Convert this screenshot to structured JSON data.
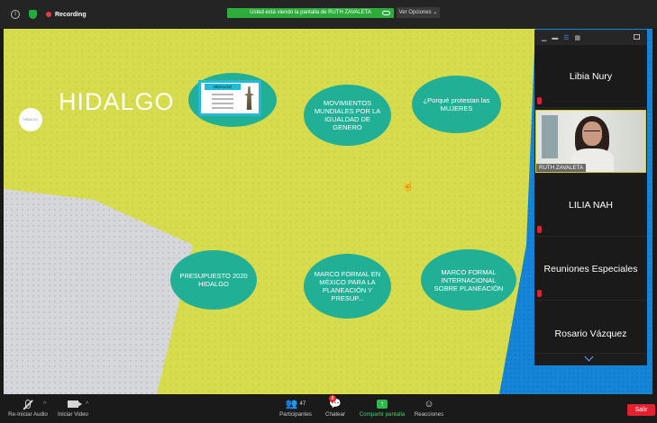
{
  "topbar": {
    "recording_label": "Recording",
    "share_banner": "Usted está viendo la pantalla de RUTH ZAVALETA",
    "view_options": "Ver Opciones"
  },
  "slide": {
    "title": "HIDALGO",
    "badge_text": "HIDALGO",
    "thumbnail_title": "HIDALGO",
    "items": [
      "MOVIMIENTOS MUNDIALES POR LA IGUALDAD DE GENERO",
      "¿Porqué protestan las MUJERES",
      "PRESUPUESTO 2020 HIDALGO",
      "MARCO FORMAL EN MÉXICO PARA LA PLANEACIÓN Y PRESUP...",
      "MARCO FORMAL INTERNACIONAL SOBRE PLANEACIÓN"
    ]
  },
  "participants": [
    {
      "name": "Libia Nury",
      "muted": true,
      "video": false
    },
    {
      "name": "RUTH ZAVALETA",
      "muted": false,
      "video": true
    },
    {
      "name": "LILIA NAH",
      "muted": true,
      "video": false
    },
    {
      "name": "Reuniones Especiales",
      "muted": true,
      "video": false
    },
    {
      "name": "Rosario Vázquez",
      "muted": false,
      "video": false
    }
  ],
  "toolbar": {
    "audio_label": "Re-Iniciar Audio",
    "video_label": "Iniciar Video",
    "participants_label": "Participantes",
    "participants_count": "47",
    "chat_label": "Chatear",
    "chat_badge": "8",
    "share_label": "Compartir pantalla",
    "reactions_label": "Reacciones",
    "end_label": "Salir"
  },
  "colors": {
    "share_green": "#2dab3b",
    "oval_teal": "#21b096",
    "end_red": "#e3222e",
    "active_speaker": "#d8c728"
  }
}
